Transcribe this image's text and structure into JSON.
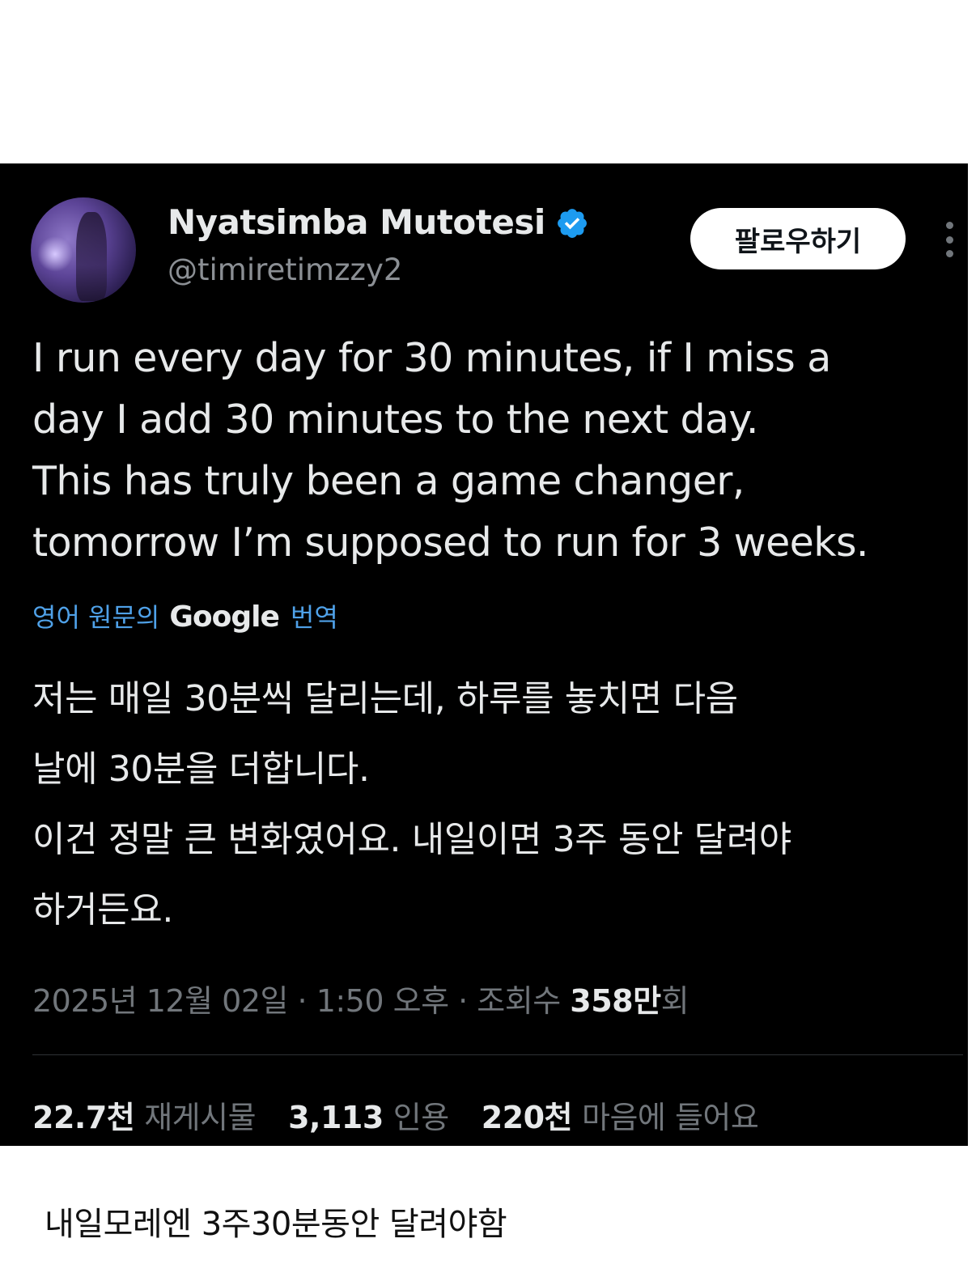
{
  "tweet": {
    "author": {
      "display_name": "Nyatsimba Mutotesi",
      "handle": "@timiretimzzy2",
      "verified": true
    },
    "follow_label": "팔로우하기",
    "text": "I run every day for 30 minutes, if I miss a\nday I add 30 minutes to the next day.\nThis has truly been a game changer,\ntomorrow I’m supposed to run for 3 weeks.",
    "translate": {
      "pre": "영어 원문의",
      "brand": "Google",
      "post": "번역"
    },
    "translated_text": "저는 매일 30분씩 달리는데, 하루를 놓치면 다음\n날에 30분을 더합니다.\n이건 정말 큰 변화였어요. 내일이면 3주 동안 달려야\n하거든요.",
    "meta": {
      "date": "2025년 12월 02일",
      "separator1": " · ",
      "time": "1:50 오후",
      "separator2": " · ",
      "views_label": "조회수 ",
      "views_value": "358만",
      "views_suffix": "회"
    },
    "stats": [
      {
        "value": "22.7천",
        "label": "재게시물"
      },
      {
        "value": "3,113",
        "label": "인용"
      },
      {
        "value": "220천",
        "label": "마음에 들어요"
      }
    ]
  },
  "caption": "내일모레엔 3주30분동안 달려야함",
  "colors": {
    "background": "#000000",
    "text": "#e7e9ea",
    "muted": "#71767b",
    "link": "#4fa1e8",
    "verified": "#1d9bf0"
  }
}
